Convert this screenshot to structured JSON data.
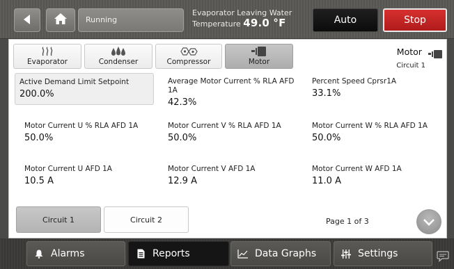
{
  "header": {
    "status": "Running",
    "measurement_label_line1": "Evaporator Leaving Water",
    "measurement_label_line2": "Temperature",
    "measurement_value": "49.0 °F",
    "auto_label": "Auto",
    "stop_label": "Stop"
  },
  "tabs": [
    {
      "label": "Evaporator",
      "icon": "heat-waves-icon"
    },
    {
      "label": "Condenser",
      "icon": "water-drops-icon"
    },
    {
      "label": "Compressor",
      "icon": "compressor-icon"
    },
    {
      "label": "Motor",
      "icon": "motor-icon",
      "active": true
    }
  ],
  "section": {
    "title": "Motor",
    "subtitle": "Circuit 1",
    "icon": "motor-icon"
  },
  "grid": [
    {
      "label": "Active Demand Limit Setpoint",
      "value": "200.0%"
    },
    {
      "label": "Average Motor Current % RLA AFD 1A",
      "value": "42.3%"
    },
    {
      "label": "Percent Speed Cprsr1A",
      "value": "33.1%"
    },
    {
      "label": "Motor Current U % RLA AFD 1A",
      "value": "50.0%"
    },
    {
      "label": "Motor Current V % RLA AFD 1A",
      "value": "50.0%"
    },
    {
      "label": "Motor Current W % RLA AFD 1A",
      "value": "50.0%"
    },
    {
      "label": "Motor Current U AFD 1A",
      "value": "10.5 A"
    },
    {
      "label": "Motor Current V AFD 1A",
      "value": "12.9 A"
    },
    {
      "label": "Motor Current W AFD 1A",
      "value": "11.0 A"
    }
  ],
  "circuits": [
    {
      "label": "Circuit 1",
      "active": true
    },
    {
      "label": "Circuit 2",
      "active": false
    }
  ],
  "pagination": {
    "label": "Page 1 of 3"
  },
  "nav": [
    {
      "label": "Alarms",
      "icon": "bell-icon"
    },
    {
      "label": "Reports",
      "icon": "document-icon",
      "active": true
    },
    {
      "label": "Data Graphs",
      "icon": "chart-icon"
    },
    {
      "label": "Settings",
      "icon": "sliders-icon"
    }
  ],
  "colors": {
    "stop": "#c42424",
    "auto": "#141414",
    "active_tab": "#b9b9b9"
  }
}
